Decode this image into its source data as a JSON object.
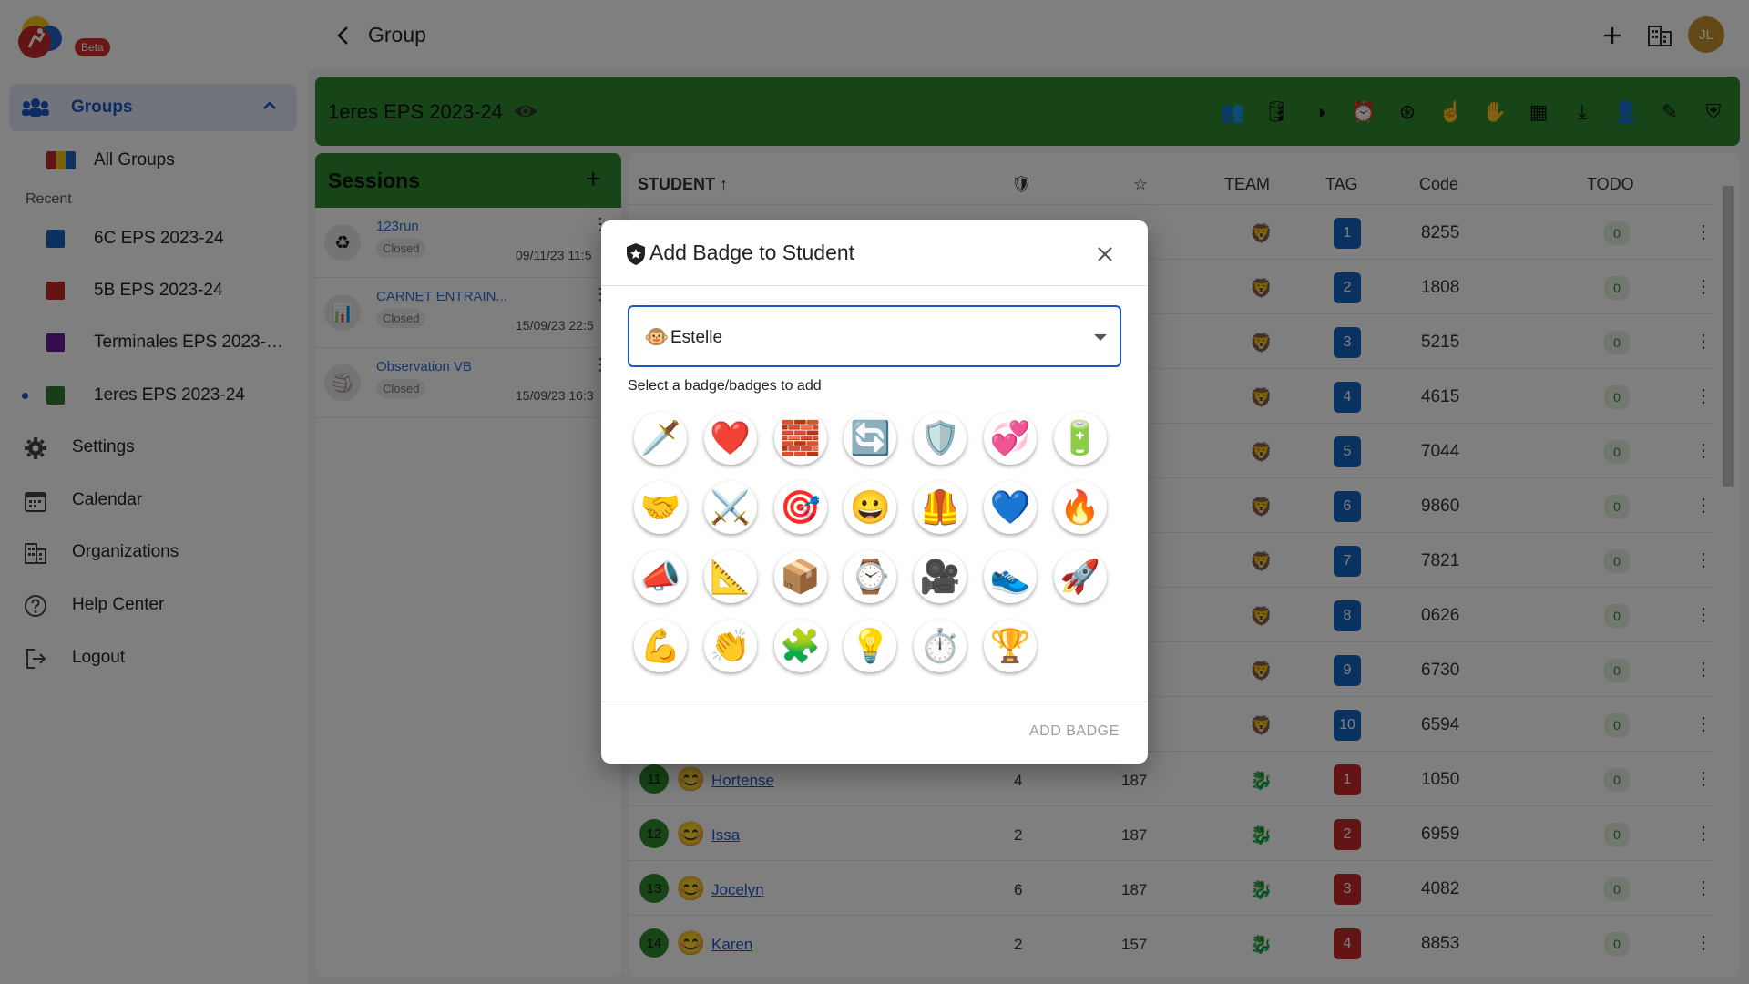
{
  "app": {
    "beta_label": "Beta"
  },
  "sidebar": {
    "groups_label": "Groups",
    "all_groups_label": "All Groups",
    "recent_label": "Recent",
    "recent_groups": [
      {
        "label": "6C EPS 2023-24",
        "color": "#1565c0"
      },
      {
        "label": "5B EPS 2023-24",
        "color": "#c62828"
      },
      {
        "label": "Terminales EPS 2023-24",
        "color": "#6a1b9a"
      },
      {
        "label": "1eres EPS 2023-24",
        "color": "#2e7d32"
      }
    ],
    "menu": [
      {
        "label": "Settings",
        "icon": "gear-icon"
      },
      {
        "label": "Calendar",
        "icon": "calendar-icon"
      },
      {
        "label": "Organizations",
        "icon": "organization-icon"
      },
      {
        "label": "Help Center",
        "icon": "help-icon"
      },
      {
        "label": "Logout",
        "icon": "logout-icon"
      }
    ]
  },
  "topbar": {
    "title": "Group",
    "avatar_initials": "JL"
  },
  "group": {
    "name": "1eres EPS 2023-24",
    "color": "#2e8b2e"
  },
  "sessions": {
    "title": "Sessions",
    "items": [
      {
        "name": "123run",
        "status": "Closed",
        "date": "09/11/23 11:5",
        "icon": "recycle-icon"
      },
      {
        "name": "CARNET ENTRAIN...",
        "status": "Closed",
        "date": "15/09/23 22:5",
        "icon": "chart-icon"
      },
      {
        "name": "Observation VB",
        "status": "Closed",
        "date": "15/09/23 16:3",
        "icon": "volleyball-icon"
      }
    ]
  },
  "table": {
    "headers": {
      "student": "STUDENT",
      "team": "TEAM",
      "tag": "TAG",
      "code": "Code",
      "todo": "TODO"
    },
    "rows": [
      {
        "num": "",
        "name": "",
        "pts": "",
        "score": "",
        "tag": "1",
        "tag_color": "#1565c0",
        "code": "8255",
        "todo": "0",
        "team": "lion"
      },
      {
        "num": "",
        "name": "",
        "pts": "",
        "score": "",
        "tag": "2",
        "tag_color": "#1565c0",
        "code": "1808",
        "todo": "0",
        "team": "lion"
      },
      {
        "num": "",
        "name": "",
        "pts": "",
        "score": "",
        "tag": "3",
        "tag_color": "#1565c0",
        "code": "5215",
        "todo": "0",
        "team": "lion"
      },
      {
        "num": "",
        "name": "",
        "pts": "",
        "score": "",
        "tag": "4",
        "tag_color": "#1565c0",
        "code": "4615",
        "todo": "0",
        "team": "lion"
      },
      {
        "num": "",
        "name": "",
        "pts": "",
        "score": "",
        "tag": "5",
        "tag_color": "#1565c0",
        "code": "7044",
        "todo": "0",
        "team": "lion"
      },
      {
        "num": "",
        "name": "",
        "pts": "",
        "score": "",
        "tag": "6",
        "tag_color": "#1565c0",
        "code": "9860",
        "todo": "0",
        "team": "lion"
      },
      {
        "num": "",
        "name": "",
        "pts": "",
        "score": "",
        "tag": "7",
        "tag_color": "#1565c0",
        "code": "7821",
        "todo": "0",
        "team": "lion"
      },
      {
        "num": "",
        "name": "",
        "pts": "",
        "score": "",
        "tag": "8",
        "tag_color": "#1565c0",
        "code": "0626",
        "todo": "0",
        "team": "lion"
      },
      {
        "num": "",
        "name": "",
        "pts": "",
        "score": "",
        "tag": "9",
        "tag_color": "#1565c0",
        "code": "6730",
        "todo": "0",
        "team": "lion"
      },
      {
        "num": "",
        "name": "",
        "pts": "",
        "score": "",
        "tag": "10",
        "tag_color": "#1565c0",
        "code": "6594",
        "todo": "0",
        "team": "lion"
      },
      {
        "num": "11",
        "name": "Hortense",
        "pts": "4",
        "score": "187",
        "tag": "1",
        "tag_color": "#c62828",
        "code": "1050",
        "todo": "0",
        "team": "dragon"
      },
      {
        "num": "12",
        "name": "Issa",
        "pts": "2",
        "score": "187",
        "tag": "2",
        "tag_color": "#c62828",
        "code": "6959",
        "todo": "0",
        "team": "dragon"
      },
      {
        "num": "13",
        "name": "Jocelyn",
        "pts": "6",
        "score": "187",
        "tag": "3",
        "tag_color": "#c62828",
        "code": "4082",
        "todo": "0",
        "team": "dragon"
      },
      {
        "num": "14",
        "name": "Karen",
        "pts": "2",
        "score": "157",
        "tag": "4",
        "tag_color": "#c62828",
        "code": "8853",
        "todo": "0",
        "team": "dragon"
      }
    ]
  },
  "dialog": {
    "title": "Add Badge to Student",
    "student_value": "Estelle",
    "select_label": "Select a badge/badges to add",
    "add_button": "ADD BADGE",
    "badges": [
      {
        "icon": "dagger-icon",
        "glyph": "🗡️"
      },
      {
        "icon": "heart-icon",
        "glyph": "❤️"
      },
      {
        "icon": "brick-icon",
        "glyph": "🧱"
      },
      {
        "icon": "refresh-icon",
        "glyph": "🔄"
      },
      {
        "icon": "shield-icon",
        "glyph": "🛡️"
      },
      {
        "icon": "heart-pair-icon",
        "glyph": "💞"
      },
      {
        "icon": "battery-icon",
        "glyph": "🔋"
      },
      {
        "icon": "handshake-icon",
        "glyph": "🤝"
      },
      {
        "icon": "crossed-swords-icon",
        "glyph": "⚔️"
      },
      {
        "icon": "target-icon",
        "glyph": "🎯"
      },
      {
        "icon": "smile-icon",
        "glyph": "😀"
      },
      {
        "icon": "armor-icon",
        "glyph": "🦺"
      },
      {
        "icon": "blue-heart-icon",
        "glyph": "💙"
      },
      {
        "icon": "fire-icon",
        "glyph": "🔥"
      },
      {
        "icon": "megaphone-icon",
        "glyph": "📣"
      },
      {
        "icon": "triangle-ruler-icon",
        "glyph": "📐"
      },
      {
        "icon": "box-icon",
        "glyph": "📦"
      },
      {
        "icon": "watch-icon",
        "glyph": "⌚"
      },
      {
        "icon": "camera-icon",
        "glyph": "🎥"
      },
      {
        "icon": "sneaker-icon",
        "glyph": "👟"
      },
      {
        "icon": "rocket-icon",
        "glyph": "🚀"
      },
      {
        "icon": "muscle-icon",
        "glyph": "💪"
      },
      {
        "icon": "clap-icon",
        "glyph": "👏"
      },
      {
        "icon": "puzzle-icon",
        "glyph": "🧩"
      },
      {
        "icon": "bulb-icon",
        "glyph": "💡"
      },
      {
        "icon": "stopwatch-icon",
        "glyph": "⏱️"
      },
      {
        "icon": "trophy-icon",
        "glyph": "🏆"
      }
    ]
  }
}
